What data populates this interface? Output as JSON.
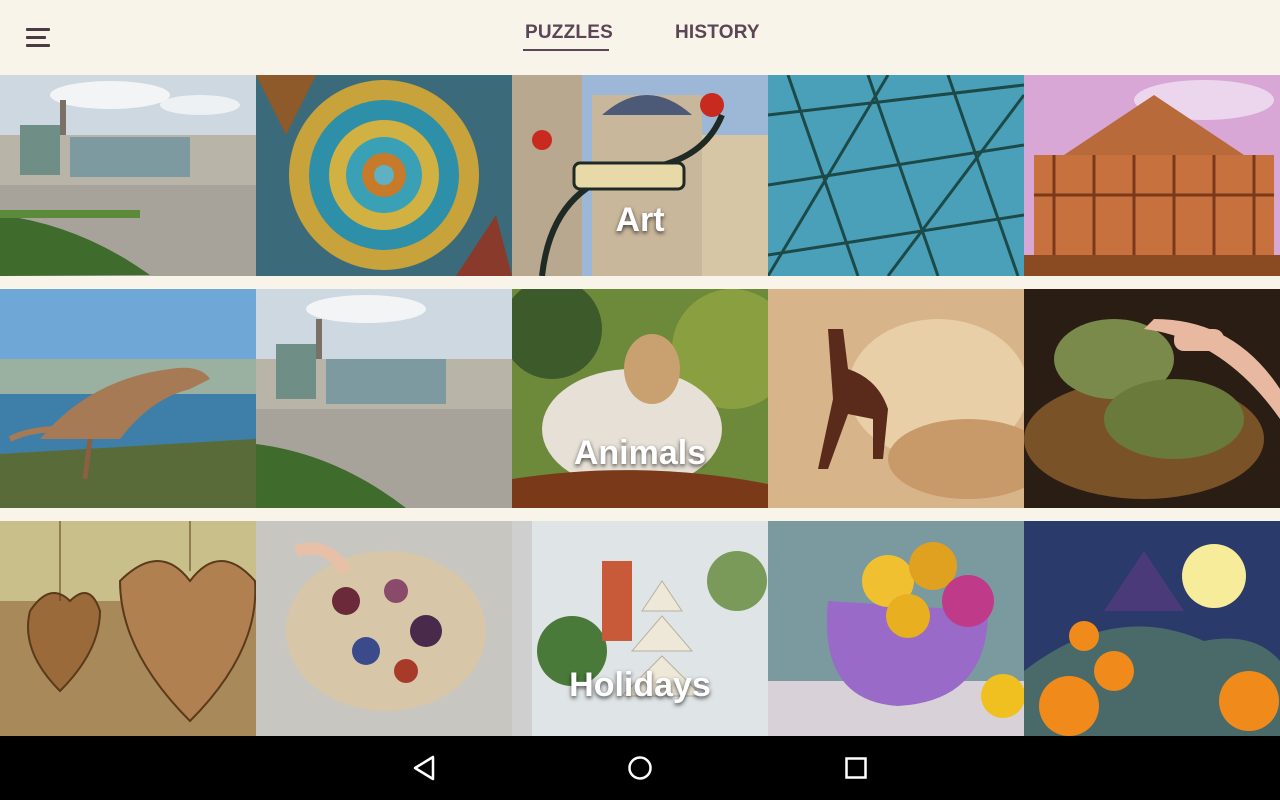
{
  "tabs": [
    {
      "label": "PUZZLES",
      "active": true
    },
    {
      "label": "HISTORY",
      "active": false
    }
  ],
  "categories": [
    {
      "label": "Art"
    },
    {
      "label": "Animals"
    },
    {
      "label": "Holidays"
    }
  ],
  "icons": {
    "menu": "hamburger-menu-icon",
    "back": "back-triangle-icon",
    "home": "home-circle-icon",
    "recents": "recents-square-icon"
  },
  "colors": {
    "background": "#f8f4ea",
    "tab_text": "#5a4655",
    "navbar": "#000000"
  }
}
